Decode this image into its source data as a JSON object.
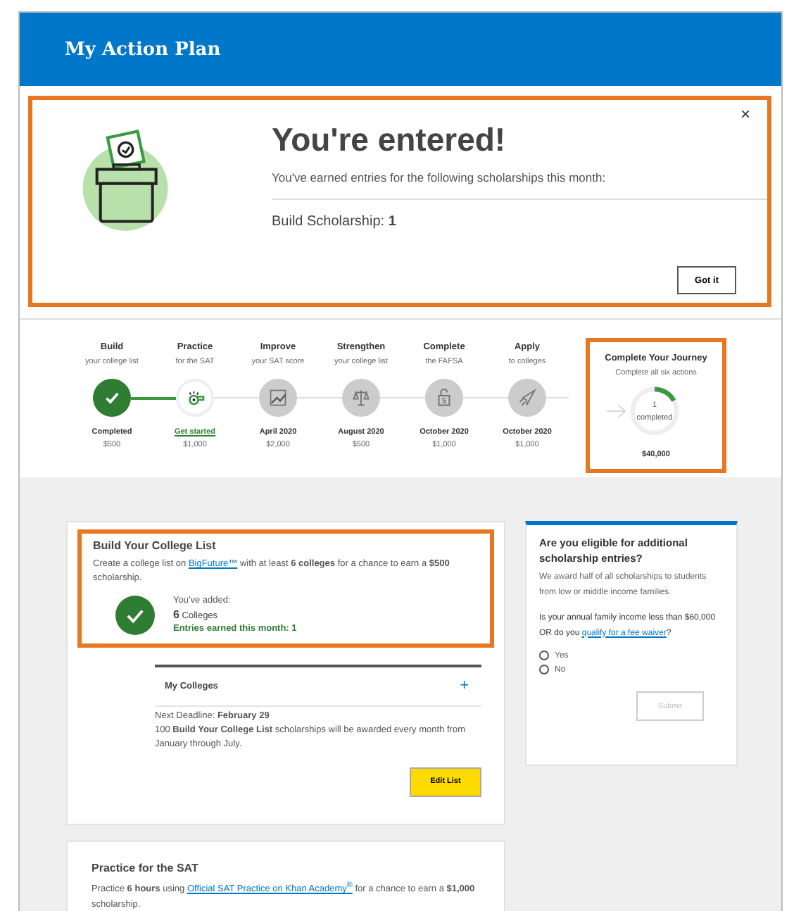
{
  "header": {
    "title": "My Action Plan"
  },
  "modal": {
    "highlighted": true,
    "close": "×",
    "title": "You're entered!",
    "message": "You've earned entries for the following scholarships this month:",
    "entry": "Build Scholarship: **1**",
    "button": "Got it"
  },
  "steps": [
    {
      "title": "Build",
      "subtitle": "your college list",
      "status": "Completed",
      "amount": "$500",
      "kind": "completed"
    },
    {
      "title": "Practice",
      "subtitle": "for the SAT",
      "status": "Get started",
      "amount": "$1,000",
      "kind": "current"
    },
    {
      "title": "Improve",
      "subtitle": "your SAT score",
      "status": "April 2020",
      "amount": "$2,000",
      "kind": "locked"
    },
    {
      "title": "Strengthen",
      "subtitle": "your college list",
      "status": "August 2020",
      "amount": "$500",
      "kind": "locked"
    },
    {
      "title": "Complete",
      "subtitle": "the FAFSA",
      "status": "October 2020",
      "amount": "$1,000",
      "kind": "locked"
    },
    {
      "title": "Apply",
      "subtitle": "to colleges",
      "status": "October 2020",
      "amount": "$1,000",
      "kind": "locked"
    }
  ],
  "journey": {
    "highlighted": true,
    "title": "Complete Your Journey",
    "subtitle": "Complete all six actions",
    "count": "1",
    "count_label": "completed",
    "level": 0.17,
    "amount": "$40,000"
  },
  "college_card": {
    "highlighted": true,
    "title": "Build Your College List",
    "text_before": "Create a college list on",
    "link": "BigFuture™",
    "text_after": "with at least **6 colleges** for a chance to earn a **$500** scholarship.",
    "added_label": "You've added:",
    "added_count": "**6** Colleges",
    "entries": "Entries earned this month: 1",
    "section_title": "My Colleges",
    "expand": "+",
    "deadline": "Next Deadline: **February 29**",
    "note": "100 **Build Your College List** scholarships will be awarded every month from January through July.",
    "button": "Edit List"
  },
  "eligibility": {
    "title": "Are you eligible for additional scholarship entries?",
    "text": "We award half of all scholarships to students from low or middle income families.",
    "question": "Is your annual family income less than $60,000 OR do you",
    "link": "qualify for a fee waiver",
    "question_end": "?",
    "options": [
      {
        "label": "Yes",
        "selected": false
      },
      {
        "label": "No",
        "selected": false
      }
    ],
    "button": "Submit",
    "button_disabled": true
  },
  "sat_card": {
    "title": "Practice for the SAT",
    "text_before": "Practice **6 hours** using",
    "link": "Official SAT Practice on Khan Academy$^{®}$",
    "text_after": "for a chance to earn a **$1,000** scholarship."
  }
}
